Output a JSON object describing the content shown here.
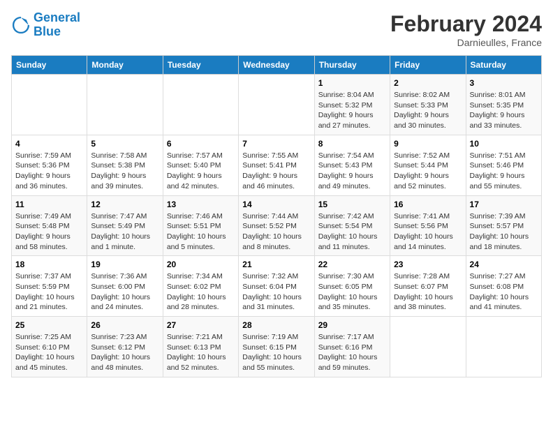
{
  "header": {
    "logo_general": "General",
    "logo_blue": "Blue",
    "main_title": "February 2024",
    "subtitle": "Darnieulles, France"
  },
  "columns": [
    "Sunday",
    "Monday",
    "Tuesday",
    "Wednesday",
    "Thursday",
    "Friday",
    "Saturday"
  ],
  "weeks": [
    [
      {
        "day": "",
        "sunrise": "",
        "sunset": "",
        "daylight": ""
      },
      {
        "day": "",
        "sunrise": "",
        "sunset": "",
        "daylight": ""
      },
      {
        "day": "",
        "sunrise": "",
        "sunset": "",
        "daylight": ""
      },
      {
        "day": "",
        "sunrise": "",
        "sunset": "",
        "daylight": ""
      },
      {
        "day": "1",
        "sunrise": "Sunrise: 8:04 AM",
        "sunset": "Sunset: 5:32 PM",
        "daylight": "Daylight: 9 hours and 27 minutes."
      },
      {
        "day": "2",
        "sunrise": "Sunrise: 8:02 AM",
        "sunset": "Sunset: 5:33 PM",
        "daylight": "Daylight: 9 hours and 30 minutes."
      },
      {
        "day": "3",
        "sunrise": "Sunrise: 8:01 AM",
        "sunset": "Sunset: 5:35 PM",
        "daylight": "Daylight: 9 hours and 33 minutes."
      }
    ],
    [
      {
        "day": "4",
        "sunrise": "Sunrise: 7:59 AM",
        "sunset": "Sunset: 5:36 PM",
        "daylight": "Daylight: 9 hours and 36 minutes."
      },
      {
        "day": "5",
        "sunrise": "Sunrise: 7:58 AM",
        "sunset": "Sunset: 5:38 PM",
        "daylight": "Daylight: 9 hours and 39 minutes."
      },
      {
        "day": "6",
        "sunrise": "Sunrise: 7:57 AM",
        "sunset": "Sunset: 5:40 PM",
        "daylight": "Daylight: 9 hours and 42 minutes."
      },
      {
        "day": "7",
        "sunrise": "Sunrise: 7:55 AM",
        "sunset": "Sunset: 5:41 PM",
        "daylight": "Daylight: 9 hours and 46 minutes."
      },
      {
        "day": "8",
        "sunrise": "Sunrise: 7:54 AM",
        "sunset": "Sunset: 5:43 PM",
        "daylight": "Daylight: 9 hours and 49 minutes."
      },
      {
        "day": "9",
        "sunrise": "Sunrise: 7:52 AM",
        "sunset": "Sunset: 5:44 PM",
        "daylight": "Daylight: 9 hours and 52 minutes."
      },
      {
        "day": "10",
        "sunrise": "Sunrise: 7:51 AM",
        "sunset": "Sunset: 5:46 PM",
        "daylight": "Daylight: 9 hours and 55 minutes."
      }
    ],
    [
      {
        "day": "11",
        "sunrise": "Sunrise: 7:49 AM",
        "sunset": "Sunset: 5:48 PM",
        "daylight": "Daylight: 9 hours and 58 minutes."
      },
      {
        "day": "12",
        "sunrise": "Sunrise: 7:47 AM",
        "sunset": "Sunset: 5:49 PM",
        "daylight": "Daylight: 10 hours and 1 minute."
      },
      {
        "day": "13",
        "sunrise": "Sunrise: 7:46 AM",
        "sunset": "Sunset: 5:51 PM",
        "daylight": "Daylight: 10 hours and 5 minutes."
      },
      {
        "day": "14",
        "sunrise": "Sunrise: 7:44 AM",
        "sunset": "Sunset: 5:52 PM",
        "daylight": "Daylight: 10 hours and 8 minutes."
      },
      {
        "day": "15",
        "sunrise": "Sunrise: 7:42 AM",
        "sunset": "Sunset: 5:54 PM",
        "daylight": "Daylight: 10 hours and 11 minutes."
      },
      {
        "day": "16",
        "sunrise": "Sunrise: 7:41 AM",
        "sunset": "Sunset: 5:56 PM",
        "daylight": "Daylight: 10 hours and 14 minutes."
      },
      {
        "day": "17",
        "sunrise": "Sunrise: 7:39 AM",
        "sunset": "Sunset: 5:57 PM",
        "daylight": "Daylight: 10 hours and 18 minutes."
      }
    ],
    [
      {
        "day": "18",
        "sunrise": "Sunrise: 7:37 AM",
        "sunset": "Sunset: 5:59 PM",
        "daylight": "Daylight: 10 hours and 21 minutes."
      },
      {
        "day": "19",
        "sunrise": "Sunrise: 7:36 AM",
        "sunset": "Sunset: 6:00 PM",
        "daylight": "Daylight: 10 hours and 24 minutes."
      },
      {
        "day": "20",
        "sunrise": "Sunrise: 7:34 AM",
        "sunset": "Sunset: 6:02 PM",
        "daylight": "Daylight: 10 hours and 28 minutes."
      },
      {
        "day": "21",
        "sunrise": "Sunrise: 7:32 AM",
        "sunset": "Sunset: 6:04 PM",
        "daylight": "Daylight: 10 hours and 31 minutes."
      },
      {
        "day": "22",
        "sunrise": "Sunrise: 7:30 AM",
        "sunset": "Sunset: 6:05 PM",
        "daylight": "Daylight: 10 hours and 35 minutes."
      },
      {
        "day": "23",
        "sunrise": "Sunrise: 7:28 AM",
        "sunset": "Sunset: 6:07 PM",
        "daylight": "Daylight: 10 hours and 38 minutes."
      },
      {
        "day": "24",
        "sunrise": "Sunrise: 7:27 AM",
        "sunset": "Sunset: 6:08 PM",
        "daylight": "Daylight: 10 hours and 41 minutes."
      }
    ],
    [
      {
        "day": "25",
        "sunrise": "Sunrise: 7:25 AM",
        "sunset": "Sunset: 6:10 PM",
        "daylight": "Daylight: 10 hours and 45 minutes."
      },
      {
        "day": "26",
        "sunrise": "Sunrise: 7:23 AM",
        "sunset": "Sunset: 6:12 PM",
        "daylight": "Daylight: 10 hours and 48 minutes."
      },
      {
        "day": "27",
        "sunrise": "Sunrise: 7:21 AM",
        "sunset": "Sunset: 6:13 PM",
        "daylight": "Daylight: 10 hours and 52 minutes."
      },
      {
        "day": "28",
        "sunrise": "Sunrise: 7:19 AM",
        "sunset": "Sunset: 6:15 PM",
        "daylight": "Daylight: 10 hours and 55 minutes."
      },
      {
        "day": "29",
        "sunrise": "Sunrise: 7:17 AM",
        "sunset": "Sunset: 6:16 PM",
        "daylight": "Daylight: 10 hours and 59 minutes."
      },
      {
        "day": "",
        "sunrise": "",
        "sunset": "",
        "daylight": ""
      },
      {
        "day": "",
        "sunrise": "",
        "sunset": "",
        "daylight": ""
      }
    ]
  ]
}
